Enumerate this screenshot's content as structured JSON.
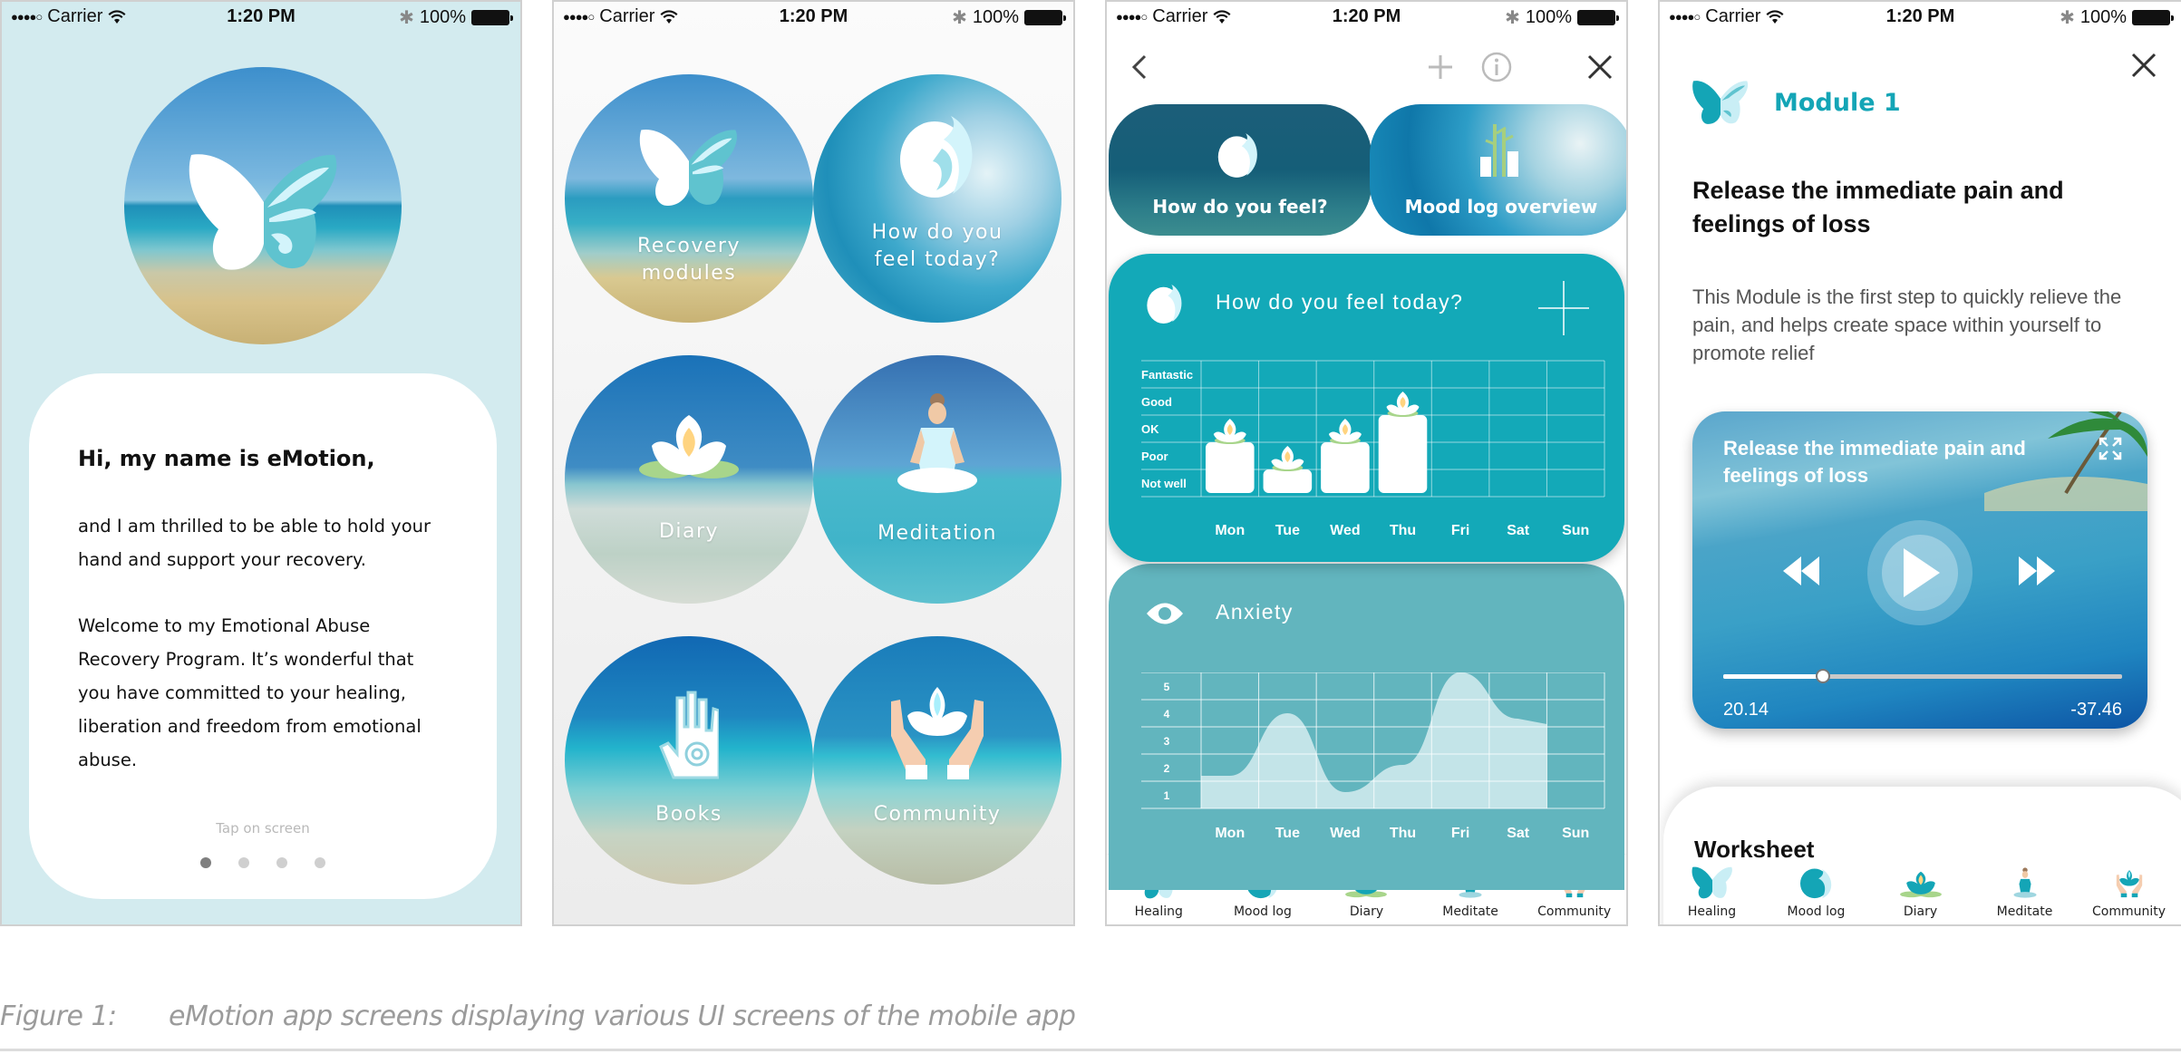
{
  "status_bar": {
    "signal": "●●●●○",
    "carrier": "Carrier",
    "time": "1:20 PM",
    "battery": "100%",
    "icons": [
      "wifi-icon",
      "bluetooth-icon",
      "battery-icon"
    ]
  },
  "screen1": {
    "greeting": "Hi, my name is eMotion,",
    "paragraph1": "and I am thrilled to be able to hold your hand and support your recovery.",
    "paragraph2": "Welcome to my Emotional Abuse Recovery Program. It’s wonderful that you have committed to your healing, liberation and freedom from emotional abuse.",
    "hint": "Tap on screen",
    "pager": {
      "pages": 4,
      "active": 1
    }
  },
  "screen2": {
    "tiles": [
      {
        "label": "Recovery modules",
        "icon": "butterfly-icon"
      },
      {
        "label": "How do you feel today?",
        "icon": "mood-swirl-icon"
      },
      {
        "label": "Diary",
        "icon": "lotus-icon"
      },
      {
        "label": "Meditation",
        "icon": "meditating-person-icon"
      },
      {
        "label": "Books",
        "icon": "spiral-hand-icon"
      },
      {
        "label": "Community",
        "icon": "hands-lotus-icon"
      }
    ]
  },
  "screen3": {
    "nav": {
      "back": "back-icon",
      "add": "plus-icon",
      "info": "info-icon",
      "close": "close-icon"
    },
    "pills": [
      {
        "label": "How do you feel?",
        "icon": "mood-swirl-icon"
      },
      {
        "label": "Mood log overview",
        "icon": "bar-chart-bamboo-icon"
      }
    ],
    "mood_card": {
      "title": "How do you feel today?"
    },
    "anxiety_card": {
      "title": "Anxiety"
    }
  },
  "tabbar": {
    "items": [
      {
        "label": "Healing",
        "icon": "butterfly-icon"
      },
      {
        "label": "Mood log",
        "icon": "mood-swirl-icon"
      },
      {
        "label": "Diary",
        "icon": "lotus-icon"
      },
      {
        "label": "Meditate",
        "icon": "meditating-person-icon"
      },
      {
        "label": "Community",
        "icon": "hands-lotus-icon"
      }
    ]
  },
  "screen4": {
    "module_label": "Module 1",
    "heading": "Release the immediate pain and feelings of loss",
    "description": "This Module is the first step to quickly relieve the pain, and helps create space within yourself to promote relief",
    "player": {
      "title": "Release the immediate pain and feelings of loss",
      "elapsed": "20.14",
      "remaining": "-37.46",
      "progress_fraction": 0.25
    },
    "worksheet_title": "Worksheet"
  },
  "caption": {
    "number": "Figure 1:",
    "text": "eMotion app screens displaying various UI screens of the mobile app"
  },
  "colors": {
    "accent": "#13a9b8",
    "anxiety_card": "#62b5be",
    "welcome_bg": "#d3ebef",
    "module_title": "#14a5b6"
  },
  "chart_data": [
    {
      "type": "bar",
      "title": "How do you feel today?",
      "categories": [
        "Mon",
        "Tue",
        "Wed",
        "Thu",
        "Fri",
        "Sat",
        "Sun"
      ],
      "y_levels": [
        "Not well",
        "Poor",
        "OK",
        "Good",
        "Fantastic"
      ],
      "values": [
        2,
        1,
        2,
        3,
        null,
        null,
        null
      ],
      "ylim": [
        0,
        5
      ],
      "grid": true,
      "marker": "lotus"
    },
    {
      "type": "area",
      "title": "Anxiety",
      "categories": [
        "Mon",
        "Tue",
        "Wed",
        "Thu",
        "Fri",
        "Sat",
        "Sun"
      ],
      "y_ticks": [
        1,
        2,
        3,
        4,
        5
      ],
      "values": [
        1.2,
        3.5,
        0.6,
        1.6,
        5.0,
        3.3,
        null
      ],
      "ylim": [
        0,
        5
      ],
      "grid": true
    }
  ]
}
